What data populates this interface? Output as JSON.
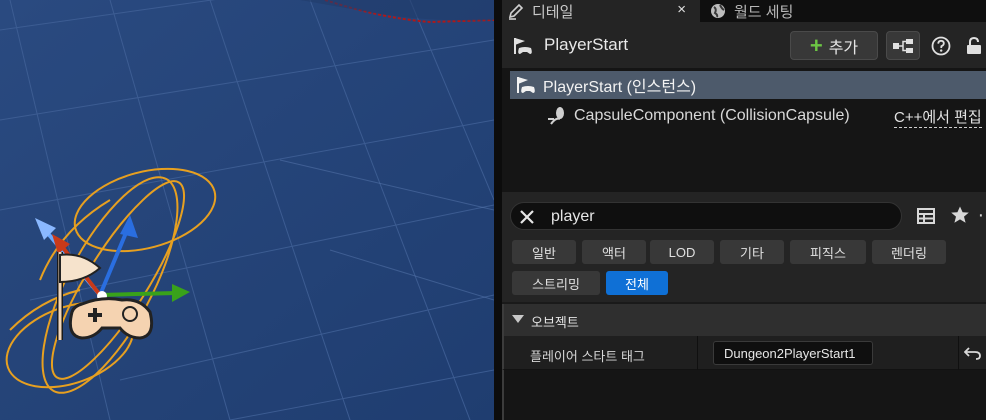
{
  "tabs": {
    "details": {
      "label": "디테일",
      "icon": "pencil-icon",
      "close_glyph": "×"
    },
    "world": {
      "label": "월드 세팅",
      "icon": "globe-icon"
    }
  },
  "header": {
    "actor_name": "PlayerStart",
    "actor_icon": "player-start-icon",
    "add_button_label": "추가",
    "blueprint_icon": "blueprint-hierarchy-icon",
    "help_icon": "help-icon",
    "lock_icon": "lock-icon"
  },
  "component_tree": {
    "root": {
      "label": "PlayerStart (인스턴스)",
      "icon": "player-start-icon"
    },
    "children": [
      {
        "label": "CapsuleComponent (CollisionCapsule)",
        "icon": "capsule-component-icon",
        "action": "C++에서 편집"
      }
    ]
  },
  "search": {
    "value": "player",
    "placeholder": ""
  },
  "filters": [
    {
      "label": "일반",
      "active": false
    },
    {
      "label": "액터",
      "active": false
    },
    {
      "label": "LOD",
      "active": false
    },
    {
      "label": "기타",
      "active": false
    },
    {
      "label": "피직스",
      "active": false
    },
    {
      "label": "렌더링",
      "active": false
    },
    {
      "label": "스트리밍",
      "active": false
    },
    {
      "label": "전체",
      "active": true
    }
  ],
  "categories": [
    {
      "label": "오브젝트",
      "expanded": true,
      "properties": [
        {
          "label": "플레이어 스타트 태그",
          "value": "Dungeon2PlayerStart1"
        }
      ]
    }
  ],
  "colors": {
    "accent": "#0f70d6",
    "selected_row": "#4d5a6b",
    "add_plus": "#6cc644",
    "viewport_floor": "#2c4e86",
    "capsule_wireframe": "#e7a020"
  }
}
